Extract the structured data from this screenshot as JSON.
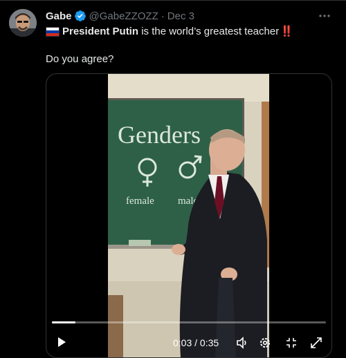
{
  "tweet": {
    "author_name": "Gabe",
    "handle": "@GabeZZOZZ",
    "separator": "·",
    "date": "Dec 3",
    "text_bold": "President Putin",
    "text_rest": " is the world’s greatest teacher",
    "text_emphasis": "‼️",
    "question": "Do you agree?"
  },
  "video": {
    "board_title": "Genders",
    "label_female": "female",
    "label_male": "male",
    "time_display": "0:03 / 0:35",
    "progress_percent": 8.6
  },
  "colors": {
    "background": "#000000",
    "text": "#e7e9ea",
    "muted": "#71767b",
    "verified_blue": "#1d9bf0",
    "chalkboard": "#2e6048"
  },
  "icons": [
    "verified-badge-icon",
    "more-icon",
    "russia-flag-icon",
    "play-icon",
    "volume-icon",
    "settings-icon",
    "fullscreen-exit-icon",
    "fullscreen-icon"
  ]
}
